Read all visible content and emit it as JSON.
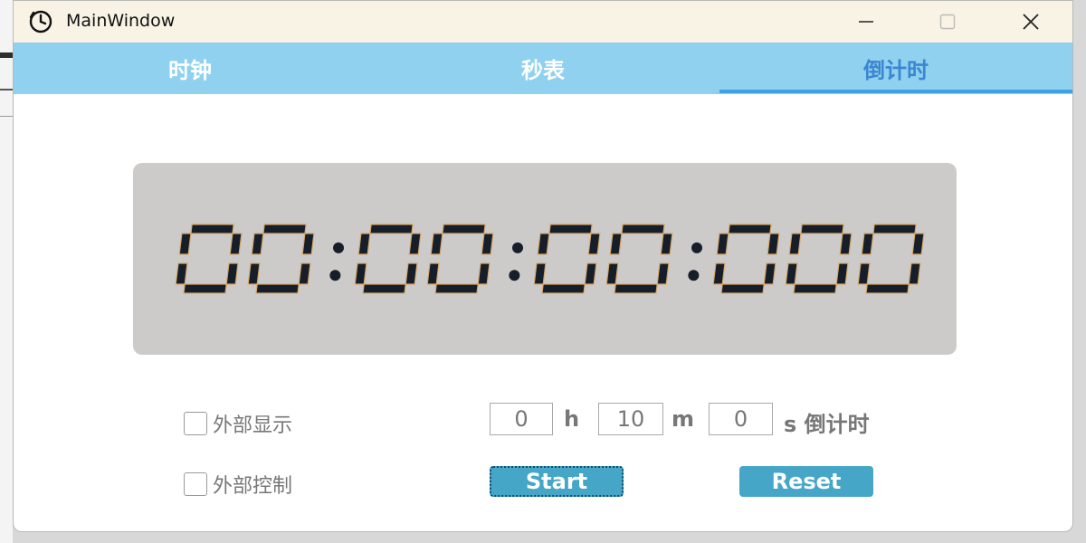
{
  "window": {
    "title": "MainWindow",
    "icon": "clock-icon"
  },
  "tabs": [
    {
      "label": "时钟",
      "active": false
    },
    {
      "label": "秒表",
      "active": false
    },
    {
      "label": "倒计时",
      "active": true
    }
  ],
  "display": {
    "time": "00:00:00:000"
  },
  "options": {
    "external_display": "外部显示",
    "external_control": "外部控制"
  },
  "countdown": {
    "hours": "0",
    "hours_unit": "h",
    "minutes": "10",
    "minutes_unit": "m",
    "seconds": "0",
    "seconds_unit": "s",
    "label": "倒计时"
  },
  "buttons": {
    "start": "Start",
    "reset": "Reset"
  },
  "colors": {
    "tab_bar": "#8fd1ee",
    "active_tab_text": "#3a86d0",
    "button": "#45a6c8",
    "display_bg": "#cccbca",
    "titlebar": "#f8f3e4"
  }
}
